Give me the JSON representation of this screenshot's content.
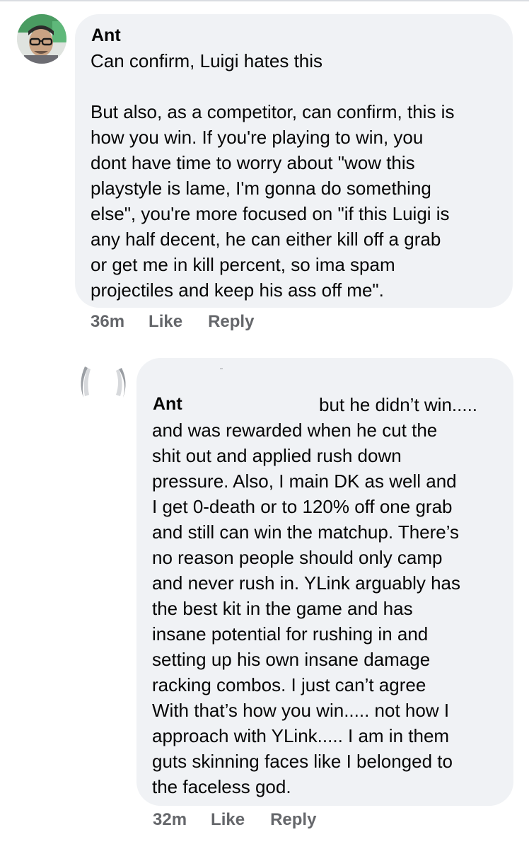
{
  "comments": [
    {
      "author": "Ant",
      "lines": [
        "Can confirm, Luigi hates this",
        "",
        "But also, as a competitor, can confirm, this is",
        "how you win. If you're playing to win, you",
        "dont have time to worry about \"wow this",
        "playstyle is lame, I'm gonna do something",
        "else\", you're more focused on \"if this Luigi is",
        "any half decent, he can either kill off a grab",
        "or get me in kill percent, so ima spam",
        "projectiles and keep his ass off me\"."
      ],
      "timestamp": "36m",
      "like_label": "Like",
      "reply_label": "Reply",
      "avatar_icon": "profile-photo-avatar"
    },
    {
      "author": "Ant",
      "tag_text": "but he didn’t win.....",
      "lines": [
        "and was rewarded when he cut the",
        "shit out and applied rush down",
        "pressure.  Also, I main DK as well and",
        "I get 0-death or to 120% off one grab",
        "and still can win the matchup. There’s",
        "no reason people should only camp",
        "and never rush in. YLink arguably has",
        "the best kit in the game and has",
        "insane potential for rushing in and",
        "setting up his own insane damage",
        "racking combos. I just can’t agree",
        "With that’s how you win..... not how I",
        "approach with YLink..... I am in them",
        "guts skinning faces like I belonged to",
        "the faceless god."
      ],
      "timestamp": "32m",
      "like_label": "Like",
      "reply_label": "Reply",
      "avatar_icon": "profile-photo-avatar"
    }
  ],
  "colors": {
    "bubble": "#f0f2f5",
    "text": "#050505",
    "meta": "#65676b"
  }
}
